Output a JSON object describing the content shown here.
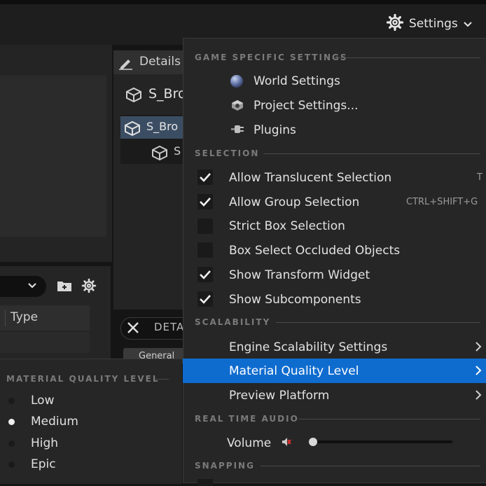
{
  "toolbar": {
    "settings_label": "Settings",
    "settings_icon": "gear-icon"
  },
  "outliner": {
    "column_type": "Type"
  },
  "details": {
    "tab_title": "Details",
    "actor_name": "S_Bro",
    "component_root": "S_Bro",
    "component_child": "S",
    "filter_label": "DETA",
    "general_tab": "General"
  },
  "settings_menu": {
    "sections": {
      "game_specific": "GAME SPECIFIC SETTINGS",
      "selection": "SELECTION",
      "scalability": "SCALABILITY",
      "real_time_audio": "REAL TIME AUDIO",
      "snapping": "SNAPPING"
    },
    "game_items": [
      {
        "label": "World Settings",
        "icon": "world-sphere-icon"
      },
      {
        "label": "Project Settings...",
        "icon": "project-cube-icon"
      },
      {
        "label": "Plugins",
        "icon": "plug-icon"
      }
    ],
    "selection_items": [
      {
        "label": "Allow Translucent Selection",
        "checked": true,
        "shortcut": "T"
      },
      {
        "label": "Allow Group Selection",
        "checked": true,
        "shortcut": "CTRL+SHIFT+G"
      },
      {
        "label": "Strict Box Selection",
        "checked": false,
        "shortcut": ""
      },
      {
        "label": "Box Select Occluded Objects",
        "checked": false,
        "shortcut": ""
      },
      {
        "label": "Show Transform Widget",
        "checked": true,
        "shortcut": ""
      },
      {
        "label": "Show Subcomponents",
        "checked": true,
        "shortcut": ""
      }
    ],
    "scalability_items": [
      {
        "label": "Engine Scalability Settings",
        "has_submenu": true
      },
      {
        "label": "Material Quality Level",
        "has_submenu": true,
        "highlighted": true
      },
      {
        "label": "Preview Platform",
        "has_submenu": true
      }
    ],
    "volume_label": "Volume",
    "volume_level": 0.0,
    "highlight_color": "#0f6ccf"
  },
  "material_quality_submenu": {
    "header": "MATERIAL QUALITY LEVEL",
    "options": [
      {
        "label": "Low",
        "selected": false
      },
      {
        "label": "Medium",
        "selected": true
      },
      {
        "label": "High",
        "selected": false
      },
      {
        "label": "Epic",
        "selected": false
      }
    ]
  }
}
